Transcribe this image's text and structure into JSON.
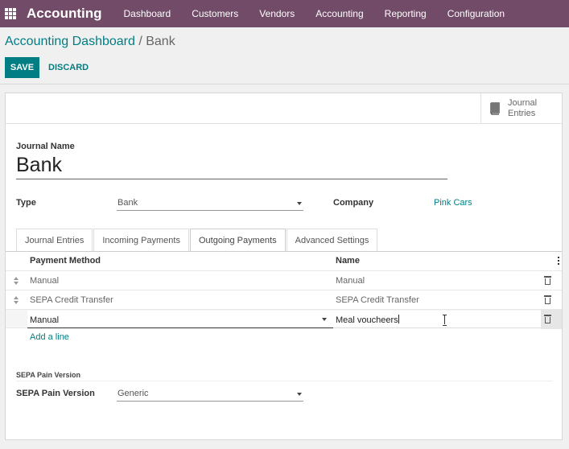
{
  "app": {
    "name": "Accounting"
  },
  "nav": [
    "Dashboard",
    "Customers",
    "Vendors",
    "Accounting",
    "Reporting",
    "Configuration"
  ],
  "breadcrumb": {
    "parent": "Accounting Dashboard",
    "separator": " / ",
    "current": "Bank"
  },
  "actions": {
    "save": "SAVE",
    "discard": "DISCARD"
  },
  "stat_button": {
    "label": "Journal Entries",
    "icon": "book-icon"
  },
  "form": {
    "journal_name_label": "Journal Name",
    "journal_name": "Bank",
    "type_label": "Type",
    "type_value": "Bank",
    "company_label": "Company",
    "company_value": "Pink Cars"
  },
  "tabs": [
    "Journal Entries",
    "Incoming Payments",
    "Outgoing Payments",
    "Advanced Settings"
  ],
  "active_tab": "Outgoing Payments",
  "table": {
    "headers": {
      "method": "Payment Method",
      "name": "Name"
    },
    "rows": [
      {
        "method": "Manual",
        "name": "Manual"
      },
      {
        "method": "SEPA Credit Transfer",
        "name": "SEPA Credit Transfer"
      }
    ],
    "editing_row": {
      "method": "Manual",
      "name": "Meal voucheers"
    },
    "add_line": "Add a line"
  },
  "sepa": {
    "section_title": "SEPA Pain Version",
    "label": "SEPA Pain Version",
    "value": "Generic"
  },
  "colors": {
    "nav_bg": "#714b67",
    "primary": "#017e84"
  }
}
